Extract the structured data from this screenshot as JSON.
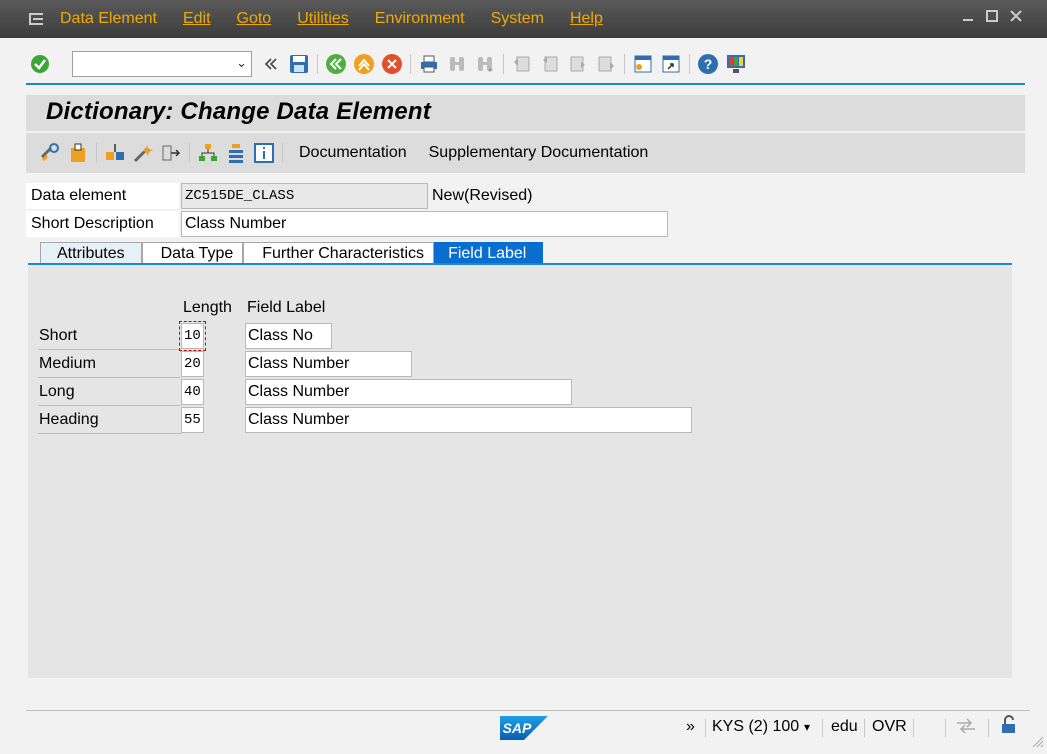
{
  "menu": {
    "items": [
      "Data Element",
      "Edit",
      "Goto",
      "Utilities",
      "Environment",
      "System",
      "Help"
    ]
  },
  "toolbar": {
    "command_field_value": "",
    "icons": [
      "enter-check-icon",
      "history-back-icon",
      "save-icon",
      "back-icon",
      "exit-icon",
      "cancel-icon",
      "print-icon",
      "find-icon",
      "find-next-icon",
      "first-page-icon",
      "previous-page-icon",
      "next-page-icon",
      "last-page-icon",
      "new-session-icon",
      "shortcut-icon",
      "help-icon",
      "customize-layout-icon"
    ]
  },
  "title": "Dictionary: Change Data Element",
  "app_toolbar": {
    "documentation": "Documentation",
    "supplementary_documentation": "Supplementary Documentation"
  },
  "header": {
    "data_element_label": "Data element",
    "data_element_value": "ZC515DE_CLASS",
    "status": "New(Revised)",
    "short_description_label": "Short Description",
    "short_description_value": "Class Number"
  },
  "tabs": [
    "Attributes",
    "Data Type",
    "Further Characteristics",
    "Field Label"
  ],
  "field_label_tab": {
    "length_header": "Length",
    "field_label_header": "Field Label",
    "rows": [
      {
        "label": "Short",
        "length": "10",
        "field_label": "Class No"
      },
      {
        "label": "Medium",
        "length": "20",
        "field_label": "Class Number"
      },
      {
        "label": "Long",
        "length": "40",
        "field_label": "Class Number"
      },
      {
        "label": "Heading",
        "length": "55",
        "field_label": "Class Number"
      }
    ]
  },
  "statusbar": {
    "arrows": "»",
    "system": "KYS (2) 100",
    "client": "edu",
    "mode": "OVR"
  },
  "colors": {
    "menu_text": "#f0ab00",
    "accent": "#0a6ed1",
    "tab_active": "#0a6ed1"
  }
}
